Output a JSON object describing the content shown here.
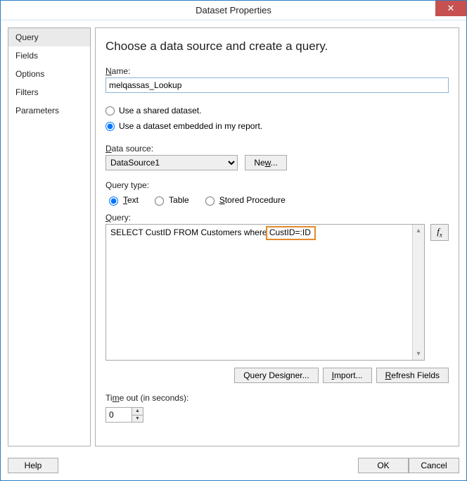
{
  "window": {
    "title": "Dataset Properties",
    "close_glyph": "✕"
  },
  "sidebar": {
    "items": [
      {
        "label": "Query",
        "selected": true
      },
      {
        "label": "Fields",
        "selected": false
      },
      {
        "label": "Options",
        "selected": false
      },
      {
        "label": "Filters",
        "selected": false
      },
      {
        "label": "Parameters",
        "selected": false
      }
    ]
  },
  "main": {
    "heading": "Choose a data source and create a query.",
    "name_label": "Name:",
    "name_value": "melqassas_Lookup",
    "radio_shared": "Use a shared dataset.",
    "radio_embedded": "Use a dataset embedded in my report.",
    "datasource_label": "Data source:",
    "datasource_value": "DataSource1",
    "new_btn": "New...",
    "querytype_label": "Query type:",
    "qt_text": "Text",
    "qt_table": "Table",
    "qt_sp": "Stored Procedure",
    "query_label": "Query:",
    "query_text_before": "SELECT CustID FROM Customers where ",
    "query_text_highlight": "CustID=:ID",
    "fx_label": "fx",
    "btn_designer": "Query Designer...",
    "btn_import": "Import...",
    "btn_refresh": "Refresh Fields",
    "timeout_label": "Time out (in seconds):",
    "timeout_value": "0"
  },
  "footer": {
    "help": "Help",
    "ok": "OK",
    "cancel": "Cancel"
  }
}
